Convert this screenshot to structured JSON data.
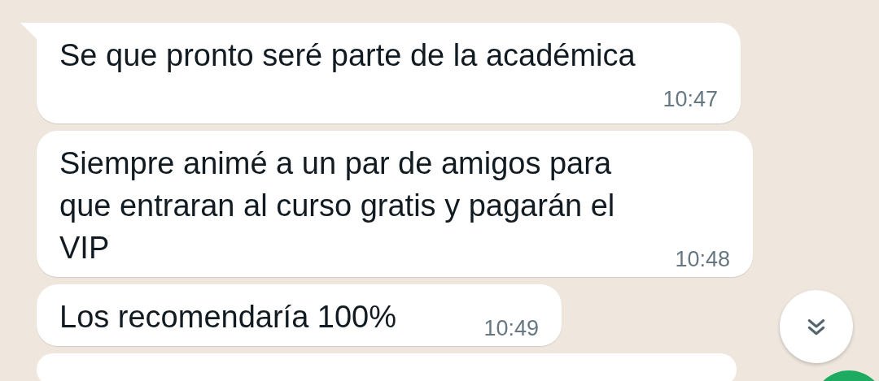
{
  "messages": [
    {
      "text": "Se que pronto seré parte de la académica",
      "time": "10:47",
      "tail": true,
      "kind": "stacked"
    },
    {
      "text": "Siempre animé a un par de amigos para que entraran al curso gratis y pagarán el VIP",
      "time": "10:48",
      "tail": false,
      "kind": "inline"
    },
    {
      "text": "Los recomendaría 100%",
      "time": "10:49",
      "tail": false,
      "kind": "inline"
    }
  ]
}
